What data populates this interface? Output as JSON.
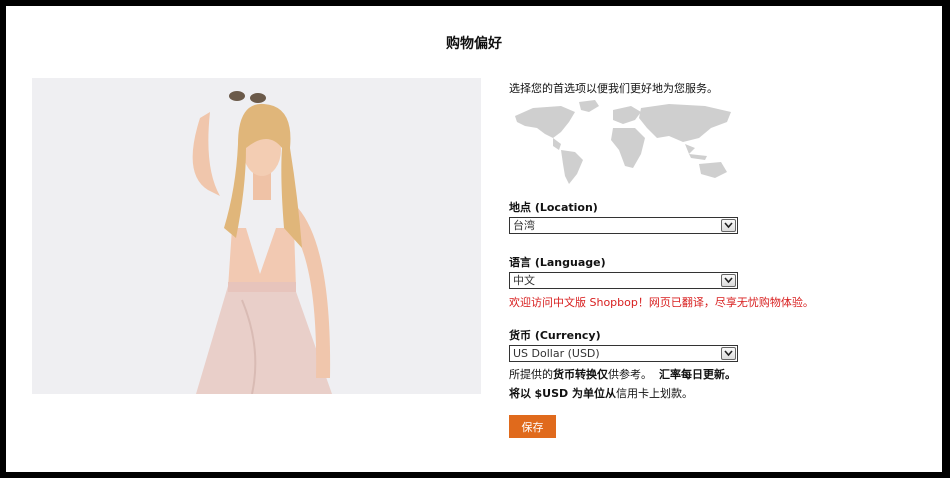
{
  "page": {
    "title": "购物偏好"
  },
  "intro": "选择您的首选项以便我们更好地为您服务。",
  "location": {
    "label": "地点 (Location)",
    "value": "台湾"
  },
  "language": {
    "label": "语言 (Language)",
    "value": "中文",
    "notice": "欢迎访问中文版 Shopbop！网页已翻译，尽享无忧购物体验。"
  },
  "currency": {
    "label": "货币 (Currency)",
    "value": "US Dollar (USD)",
    "note1_a": "所提供的",
    "note1_b": "货币转换仅",
    "note1_c": "供参考。",
    "note1_d": "汇率每日更新。",
    "note2_a": "将以",
    "note2_b": "$USD 为单位从",
    "note2_c": "信用卡上划款。"
  },
  "save_label": "保存",
  "colors": {
    "accent": "#e06a1c",
    "notice": "#d81e1e",
    "map": "#cfcfcf"
  },
  "icons": [
    "world-map-icon",
    "chevron-down-icon"
  ]
}
